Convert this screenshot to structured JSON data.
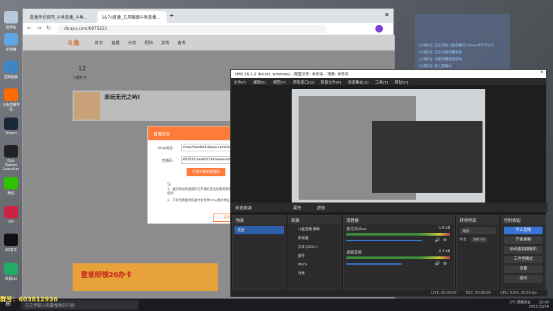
{
  "chrome": {
    "tabs": [
      {
        "label": "直播伴侣官网_斗鱼直播_斗鱼..."
      },
      {
        "label": "1&7o直播_五月暖跟斗鱼直播..."
      }
    ],
    "url": "douyu.com/6975221",
    "site": {
      "logo": "斗鱼",
      "nav": [
        "首页",
        "直播",
        "分类",
        "视频",
        "游戏",
        "备考"
      ],
      "stats": [
        "12",
        "卜额打卡"
      ],
      "room_title": "来玩无光之屿!",
      "follow_btn": "关注",
      "banner": "登录即领20办卡"
    },
    "modal": {
      "title": "直播信息",
      "rtmp_label": "rtmp地址:",
      "rtmp_value": "rtmp://sendtc3.douyu.com/live",
      "code_label": "直播码:",
      "code_value": "6975221rw4zYV1bB?wsSecret=",
      "copy_btn": "已成功复制直播码",
      "note_title": "注:",
      "note1": "1、推流地址和直播码在开播前变化后需要重新复制后再转为使用",
      "note2": "2、只有切换推流机器才会导致rtmp推流地址",
      "close_btn": "关闭"
    }
  },
  "obs": {
    "title": "OBS 26.1.2 (64-bit, windows) - 配置文件: 未命名 - 场景: 未命名",
    "menu": [
      "文件(F)",
      "编辑(E)",
      "视图(V)",
      "停靠窗口(D)",
      "配置文件(P)",
      "场景集合(S)",
      "工具(T)",
      "帮助(H)"
    ],
    "preview_bar": {
      "scene": "未选择源",
      "props": "属性",
      "filters": "滤镜"
    },
    "scenes": {
      "title": "场景",
      "items": [
        "场景"
      ]
    },
    "sources": {
      "title": "来源",
      "items": [
        "斗鱼直播 弹幕",
        "新浪播",
        "文本 (GDI+)",
        "群号",
        "disco",
        "背景"
      ]
    },
    "mixer": {
      "title": "混音器",
      "channels": [
        {
          "name": "麦克风/Aux",
          "db": "-1.6 dB"
        },
        {
          "name": "桌面音频",
          "db": "-0.7 dB"
        }
      ],
      "scale": [
        "-60",
        "-55",
        "-50",
        "-45",
        "-40",
        "-35",
        "-30",
        "-25",
        "-20",
        "-15",
        "-10",
        "-5",
        "0"
      ]
    },
    "transitions": {
      "title": "转场特效",
      "type": "渐变",
      "duration_label": "时长",
      "duration": "300 ms"
    },
    "controls": {
      "title": "控制按钮",
      "buttons": [
        "停止直播",
        "开始录制",
        "启动虚拟摄像机",
        "工作室模式",
        "设置",
        "退出"
      ]
    },
    "status": {
      "live": "LIVE: 00:00:00",
      "rec": "REC: 00:00:00",
      "cpu": "CPU: 0.8%, 30.00 fps"
    }
  },
  "overlay": {
    "lines": [
      "[小路内]: 正在加载斗鱼直播间,Douyu/6975221",
      "[小路内]: 正在与服务器连接",
      "[小路内]: 与服务器连接成功",
      "[小路内]: 进入直播间"
    ]
  },
  "desktop": {
    "icons": [
      "回收站",
      "此电脑",
      "控制面板",
      "斗鱼直播伴侣",
      "Steam",
      "Epic Games Launcher",
      "微信",
      "QQ",
      "QQ音乐",
      "网易UU"
    ]
  },
  "taskbar": {
    "search": "在这里输入你要搜索的内容",
    "weather": "2°C 局部多云",
    "time": "22:03",
    "date": "2021/12/14",
    "banner": "群号：603812936"
  }
}
